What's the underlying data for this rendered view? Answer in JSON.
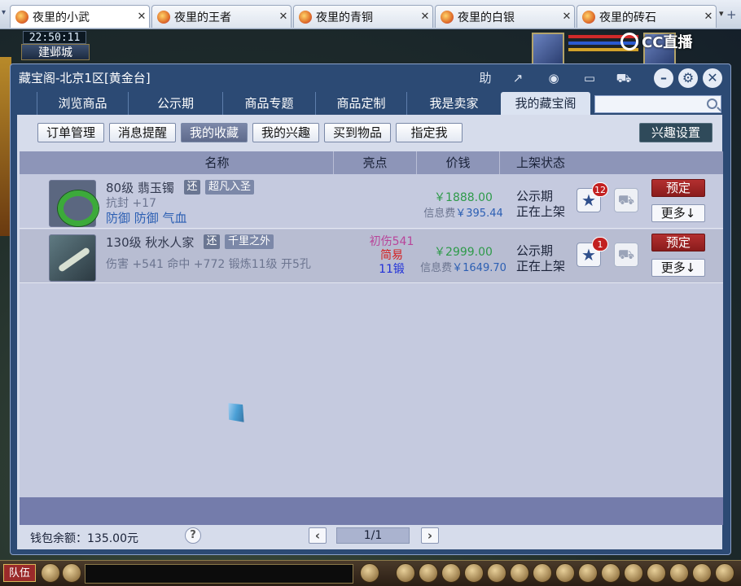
{
  "browser": {
    "tabs": [
      {
        "title": "夜里的小武",
        "active": true
      },
      {
        "title": "夜里的王者",
        "active": false
      },
      {
        "title": "夜里的青铜",
        "active": false
      },
      {
        "title": "夜里的白银",
        "active": false
      },
      {
        "title": "夜里的砖石",
        "active": false
      }
    ],
    "close_glyph": "✕",
    "add_glyph": "+",
    "menu_glyph": "▾"
  },
  "game": {
    "clock": "22:50:11",
    "location": "建邺城",
    "stream_logo": "CC直播",
    "bottom": {
      "team_label": "队伍"
    }
  },
  "window": {
    "title": "藏宝阁-北京1区[黄金台]",
    "help_label": "助",
    "main_tabs": [
      "浏览商品",
      "公示期",
      "商品专题",
      "商品定制",
      "我是卖家",
      "我的藏宝阁"
    ],
    "active_main_tab": "我的藏宝阁",
    "search": {
      "placeholder": ""
    },
    "sub_tabs": [
      "订单管理",
      "消息提醒",
      "我的收藏",
      "我的兴趣",
      "买到物品",
      "指定我"
    ],
    "active_sub_tab": "我的收藏",
    "interest_settings_label": "兴趣设置",
    "columns": [
      "名称",
      "亮点",
      "价钱",
      "上架状态"
    ],
    "items": [
      {
        "icon": "jade-bracelet-icon",
        "name": "80级 翡玉镯",
        "return_tag": "还",
        "title_tag": "超凡入圣",
        "stat1": "抗封 +17",
        "stat2": "防御 防御 气血",
        "highlights": [],
        "price": "￥1888.00",
        "fee_label": "信息费",
        "fee_value": "￥395.44",
        "status1": "公示期",
        "status2": "正在上架",
        "star_count": "12",
        "reserve_label": "预定",
        "more_label": "更多↓"
      },
      {
        "icon": "sword-icon",
        "name": "130级 秋水人家",
        "return_tag": "还",
        "title_tag": "千里之外",
        "stat1": "伤害 +541 命中 +772 锻炼11级 开5孔",
        "stat2": "",
        "highlights": [
          {
            "text": "初伤541",
            "color": "#b8459a"
          },
          {
            "text": "简易",
            "color": "#d42020"
          },
          {
            "text": "11锻",
            "color": "#2030d8"
          }
        ],
        "price": "￥2999.00",
        "fee_label": "信息费",
        "fee_value": "￥1649.70",
        "status1": "公示期",
        "status2": "正在上架",
        "star_count": "1",
        "reserve_label": "预定",
        "more_label": "更多↓"
      }
    ],
    "wallet": "钱包余额：135.00元",
    "help_icon": "?",
    "pagination": {
      "prev": "‹",
      "current": "1/1",
      "next": "›"
    }
  },
  "colors": {
    "accent": "#2c4a74",
    "price_green": "#2e9a4a",
    "reserve_red": "#b33030"
  }
}
